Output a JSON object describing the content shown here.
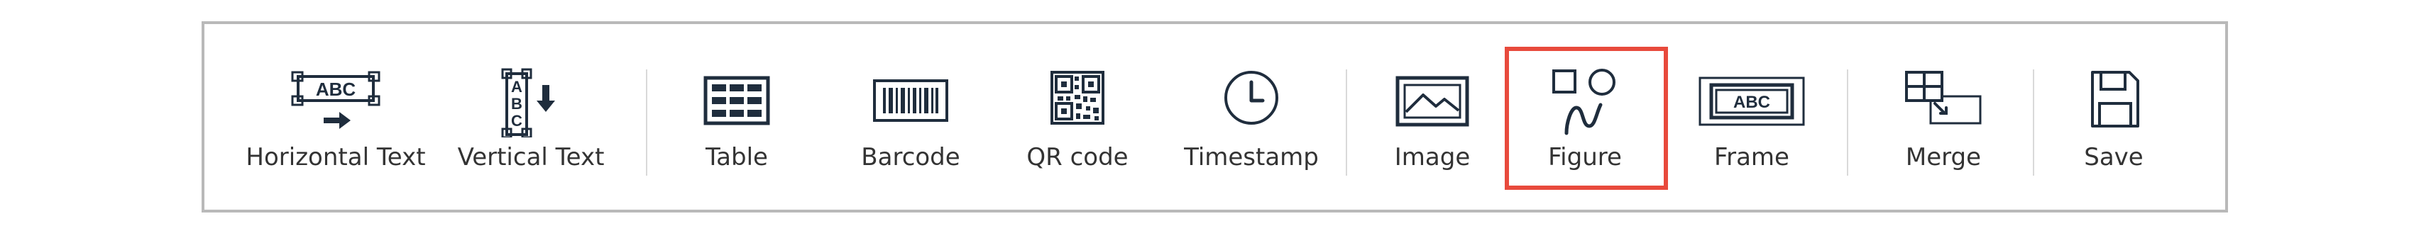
{
  "colors": {
    "toolbar_border": "#b9b9b9",
    "icon": "#1f2d3d",
    "label": "#333333",
    "separator": "#d9d9d9",
    "selection_highlight": "#e84a3c"
  },
  "toolbar": {
    "items": [
      {
        "label": "Horizontal Text",
        "icon": "horizontal-text-icon",
        "icon_text": "ABC"
      },
      {
        "label": "Vertical Text",
        "icon": "vertical-text-icon",
        "icon_text": [
          "A",
          "B",
          "C"
        ]
      },
      {
        "label": "Table",
        "icon": "table-icon"
      },
      {
        "label": "Barcode",
        "icon": "barcode-icon"
      },
      {
        "label": "QR code",
        "icon": "qr-code-icon"
      },
      {
        "label": "Timestamp",
        "icon": "clock-icon"
      },
      {
        "label": "Image",
        "icon": "image-icon"
      },
      {
        "label": "Figure",
        "icon": "figure-icon",
        "highlighted": true
      },
      {
        "label": "Frame",
        "icon": "frame-icon",
        "icon_text": "ABC"
      },
      {
        "label": "Merge",
        "icon": "merge-icon"
      },
      {
        "label": "Save",
        "icon": "save-icon"
      }
    ]
  }
}
